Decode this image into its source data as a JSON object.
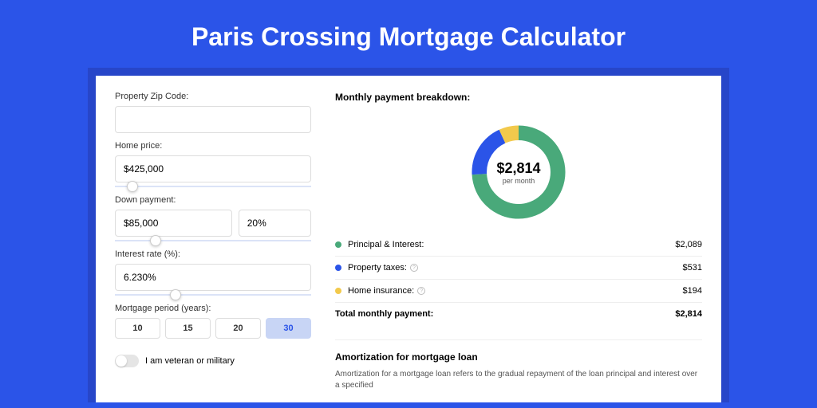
{
  "title": "Paris Crossing Mortgage Calculator",
  "form": {
    "zip_label": "Property Zip Code:",
    "zip_value": "",
    "home_price_label": "Home price:",
    "home_price_value": "$425,000",
    "down_payment_label": "Down payment:",
    "down_payment_value": "$85,000",
    "down_payment_pct": "20%",
    "rate_label": "Interest rate (%):",
    "rate_value": "6.230%",
    "period_label": "Mortgage period (years):",
    "periods": [
      "10",
      "15",
      "20",
      "30"
    ],
    "active_period": "30",
    "veteran_label": "I am veteran or military"
  },
  "breakdown": {
    "title": "Monthly payment breakdown:",
    "center_value": "$2,814",
    "center_sub": "per month",
    "items": [
      {
        "label": "Principal & Interest:",
        "value": "$2,089",
        "color": "#49a97a",
        "pct": 74,
        "info": false
      },
      {
        "label": "Property taxes:",
        "value": "$531",
        "color": "#2b54e8",
        "pct": 19,
        "info": true
      },
      {
        "label": "Home insurance:",
        "value": "$194",
        "color": "#f2c94c",
        "pct": 7,
        "info": true
      }
    ],
    "total_label": "Total monthly payment:",
    "total_value": "$2,814"
  },
  "amortization": {
    "title": "Amortization for mortgage loan",
    "text": "Amortization for a mortgage loan refers to the gradual repayment of the loan principal and interest over a specified"
  },
  "chart_data": {
    "type": "pie",
    "title": "Monthly payment breakdown",
    "series": [
      {
        "name": "Principal & Interest",
        "value": 2089,
        "color": "#49a97a"
      },
      {
        "name": "Property taxes",
        "value": 531,
        "color": "#2b54e8"
      },
      {
        "name": "Home insurance",
        "value": 194,
        "color": "#f2c94c"
      }
    ],
    "total": 2814
  }
}
